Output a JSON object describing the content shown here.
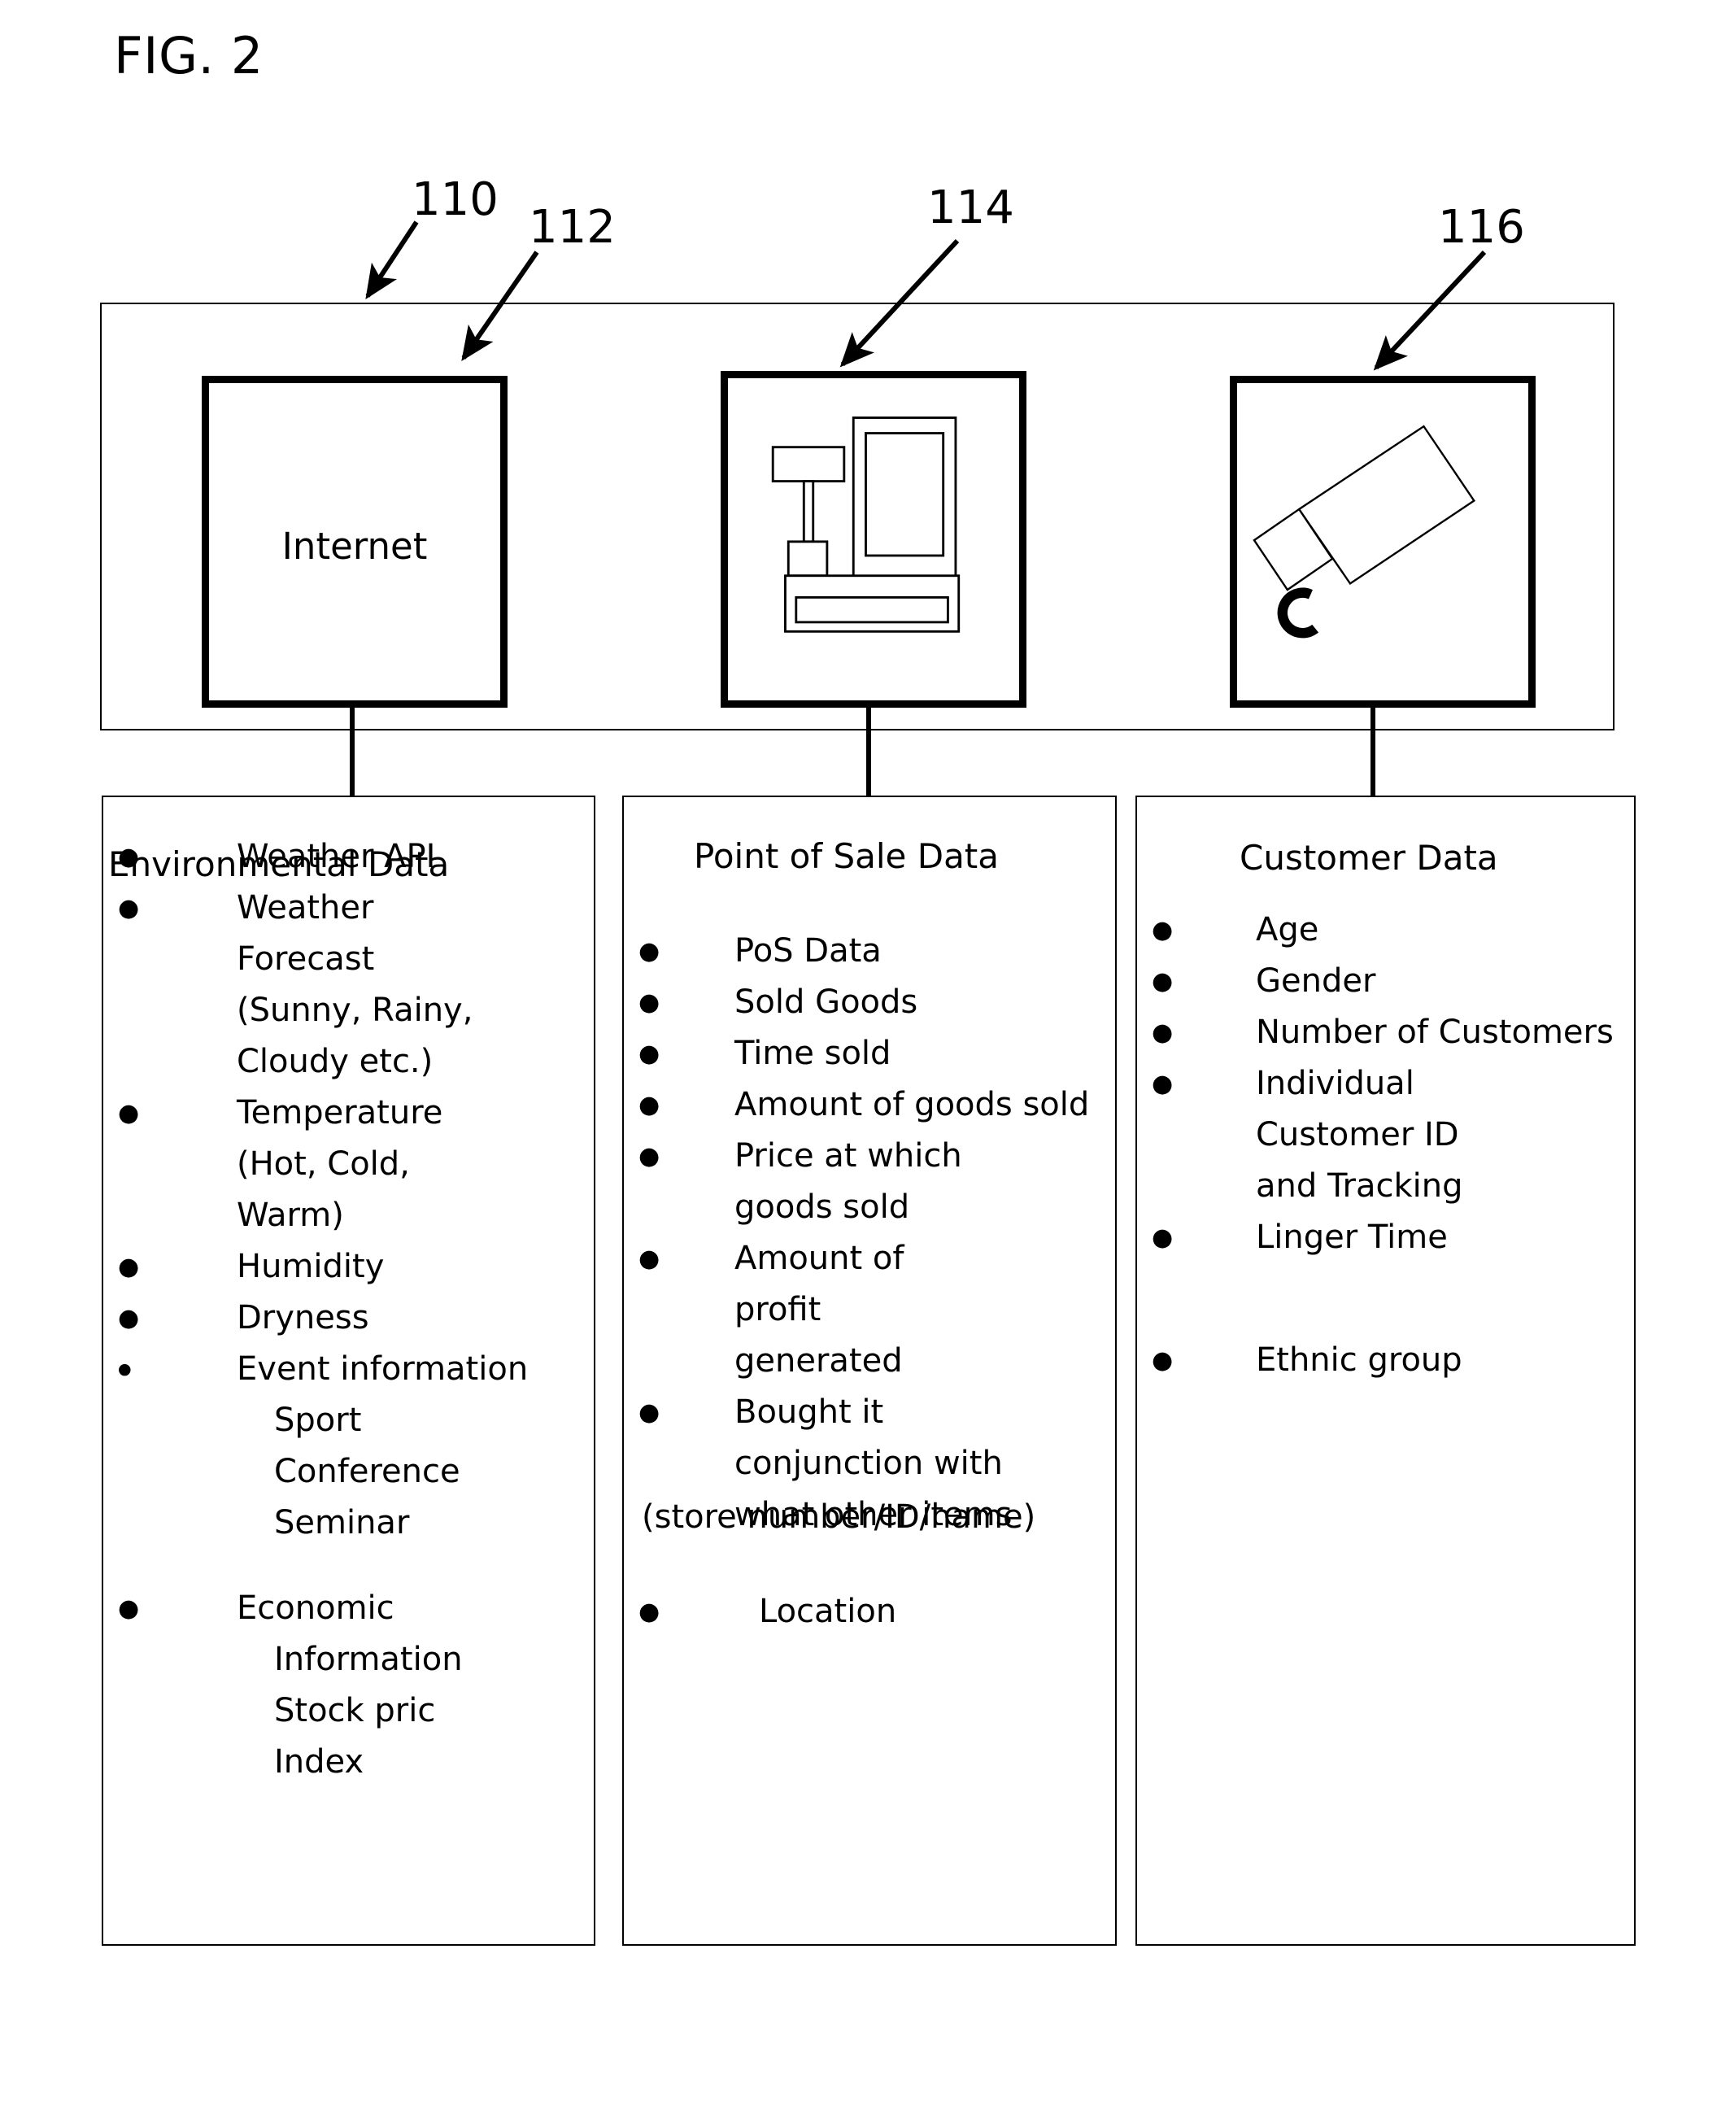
{
  "figure": {
    "title": "FIG. 2"
  },
  "reference_numerals": [
    {
      "id": "110",
      "label": "110",
      "points_to": "source-container"
    },
    {
      "id": "112",
      "label": "112",
      "points_to": "internet-box"
    },
    {
      "id": "114",
      "label": "114",
      "points_to": "pos-box"
    },
    {
      "id": "116",
      "label": "116",
      "points_to": "camera-box"
    }
  ],
  "sources": {
    "internet": {
      "label": "Internet",
      "icon": "internet-text-box"
    },
    "point_of_sale": {
      "label": "",
      "icon": "cash-register-icon"
    },
    "camera": {
      "label": "",
      "icon": "security-camera-icon"
    }
  },
  "columns": [
    {
      "key": "environmental",
      "heading": "Environmental Data",
      "items": [
        {
          "text": "Weather API",
          "bullet": "large"
        },
        {
          "text": "Weather Forecast (Sunny, Rainy, Cloudy etc.)",
          "bullet": "large"
        },
        {
          "text": "Temperature (Hot, Cold, Warm)",
          "bullet": "large"
        },
        {
          "text": "Humidity",
          "bullet": "large"
        },
        {
          "text": "Dryness",
          "bullet": "large"
        },
        {
          "text": "Event information",
          "bullet": "small",
          "sub_items": [
            "Sport",
            "Conference",
            "Seminar"
          ]
        },
        {
          "text": "Economic",
          "bullet": "large",
          "sub_items": [
            "Information",
            "Stock pric",
            "Index"
          ]
        }
      ]
    },
    {
      "key": "point_of_sale",
      "heading": "Point of Sale Data",
      "items": [
        {
          "text": "PoS Data",
          "bullet": "large"
        },
        {
          "text": "Sold Goods",
          "bullet": "large"
        },
        {
          "text": "Time sold",
          "bullet": "large"
        },
        {
          "text": "Amount of goods sold",
          "bullet": "large"
        },
        {
          "text": "Price at which goods sold",
          "bullet": "large"
        },
        {
          "text": "Amount of profit generated",
          "bullet": "large"
        },
        {
          "text": "Bought it conjunction with what other items",
          "bullet": "large"
        },
        {
          "text": "Location",
          "bullet": "large"
        }
      ],
      "footnote": "(store number/ID/name)"
    },
    {
      "key": "customer",
      "heading": "Customer Data",
      "items": [
        {
          "text": "Age",
          "bullet": "large"
        },
        {
          "text": "Gender",
          "bullet": "large"
        },
        {
          "text": "Number of Customers",
          "bullet": "large"
        },
        {
          "text": "Individual Customer ID and Tracking",
          "bullet": "large"
        },
        {
          "text": "Linger Time",
          "bullet": "large"
        },
        {
          "text": "Ethnic group",
          "bullet": "large"
        }
      ]
    }
  ],
  "colors": {
    "ink": "#000000",
    "paper": "#ffffff"
  }
}
